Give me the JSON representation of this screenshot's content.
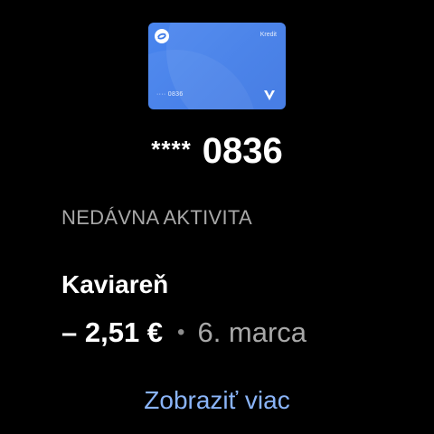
{
  "card": {
    "type_label": "Kredit",
    "number_short": "···· 0836",
    "brand_icon": "v-brand-icon",
    "logo_icon": "s-logo-icon",
    "color": "#4285f4"
  },
  "masked_number": {
    "stars": "****",
    "last_four": "0836"
  },
  "recent_activity": {
    "title": "NEDÁVNA AKTIVITA",
    "merchant": "Kaviareň",
    "amount": "– 2,51 €",
    "separator": "•",
    "date": "6. marca"
  },
  "more_link": {
    "label": "Zobraziť viac",
    "color": "#8ab4f8"
  }
}
